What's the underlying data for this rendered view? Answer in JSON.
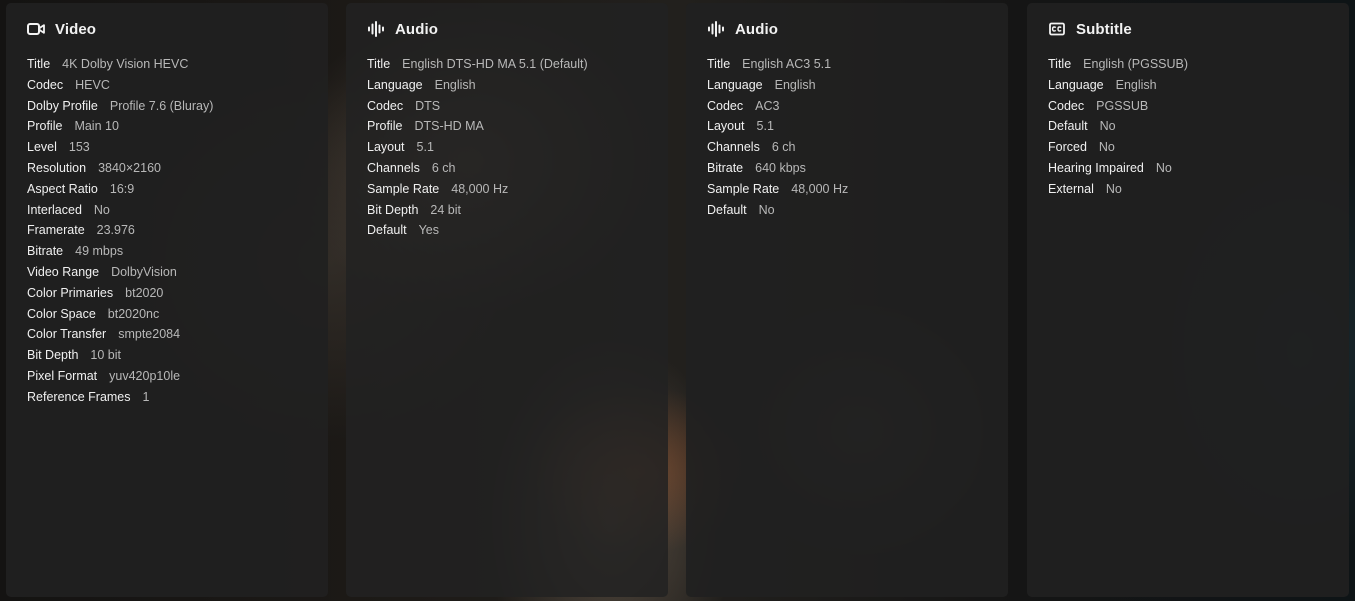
{
  "panels": [
    {
      "title": "Video",
      "icon": "video-camera-icon",
      "rows": [
        {
          "key": "Title",
          "value": "4K Dolby Vision HEVC"
        },
        {
          "key": "Codec",
          "value": "HEVC"
        },
        {
          "key": "Dolby Profile",
          "value": "Profile 7.6 (Bluray)"
        },
        {
          "key": "Profile",
          "value": "Main 10"
        },
        {
          "key": "Level",
          "value": "153"
        },
        {
          "key": "Resolution",
          "value": "3840×2160"
        },
        {
          "key": "Aspect Ratio",
          "value": "16:9"
        },
        {
          "key": "Interlaced",
          "value": "No"
        },
        {
          "key": "Framerate",
          "value": "23.976"
        },
        {
          "key": "Bitrate",
          "value": "49 mbps"
        },
        {
          "key": "Video Range",
          "value": "DolbyVision"
        },
        {
          "key": "Color Primaries",
          "value": "bt2020"
        },
        {
          "key": "Color Space",
          "value": "bt2020nc"
        },
        {
          "key": "Color Transfer",
          "value": "smpte2084"
        },
        {
          "key": "Bit Depth",
          "value": "10 bit"
        },
        {
          "key": "Pixel Format",
          "value": "yuv420p10le"
        },
        {
          "key": "Reference Frames",
          "value": "1"
        }
      ]
    },
    {
      "title": "Audio",
      "icon": "audio-waveform-icon",
      "rows": [
        {
          "key": "Title",
          "value": "English DTS-HD MA 5.1 (Default)"
        },
        {
          "key": "Language",
          "value": "English"
        },
        {
          "key": "Codec",
          "value": "DTS"
        },
        {
          "key": "Profile",
          "value": "DTS-HD MA"
        },
        {
          "key": "Layout",
          "value": "5.1"
        },
        {
          "key": "Channels",
          "value": "6 ch"
        },
        {
          "key": "Sample Rate",
          "value": "48,000 Hz"
        },
        {
          "key": "Bit Depth",
          "value": "24 bit"
        },
        {
          "key": "Default",
          "value": "Yes"
        }
      ]
    },
    {
      "title": "Audio",
      "icon": "audio-waveform-icon",
      "rows": [
        {
          "key": "Title",
          "value": "English AC3 5.1"
        },
        {
          "key": "Language",
          "value": "English"
        },
        {
          "key": "Codec",
          "value": "AC3"
        },
        {
          "key": "Layout",
          "value": "5.1"
        },
        {
          "key": "Channels",
          "value": "6 ch"
        },
        {
          "key": "Bitrate",
          "value": "640 kbps"
        },
        {
          "key": "Sample Rate",
          "value": "48,000 Hz"
        },
        {
          "key": "Default",
          "value": "No"
        }
      ]
    },
    {
      "title": "Subtitle",
      "icon": "closed-caption-icon",
      "rows": [
        {
          "key": "Title",
          "value": "English (PGSSUB)"
        },
        {
          "key": "Language",
          "value": "English"
        },
        {
          "key": "Codec",
          "value": "PGSSUB"
        },
        {
          "key": "Default",
          "value": "No"
        },
        {
          "key": "Forced",
          "value": "No"
        },
        {
          "key": "Hearing Impaired",
          "value": "No"
        },
        {
          "key": "External",
          "value": "No"
        }
      ]
    }
  ],
  "colors": {
    "panel_bg": "#202020",
    "label": "#f0f0f0",
    "value": "#b8b8b8"
  }
}
